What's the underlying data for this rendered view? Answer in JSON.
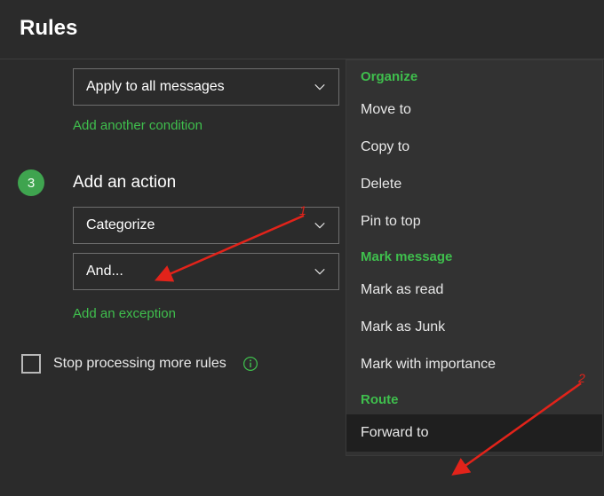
{
  "title": "Rules",
  "condition": {
    "select_label": "Apply to all messages",
    "add_link": "Add another condition"
  },
  "action": {
    "step_number": "3",
    "title": "Add an action",
    "select1_label": "Categorize",
    "select2_label": "And...",
    "add_link": "Add an exception"
  },
  "stop": {
    "label": "Stop processing more rules"
  },
  "menu": {
    "groups": [
      {
        "label": "Organize",
        "items": [
          "Move to",
          "Copy to",
          "Delete",
          "Pin to top"
        ]
      },
      {
        "label": "Mark message",
        "items": [
          "Mark as read",
          "Mark as Junk",
          "Mark with importance"
        ]
      },
      {
        "label": "Route",
        "items": [
          "Forward to"
        ]
      }
    ]
  },
  "annotation": {
    "a": "1",
    "b": "2"
  },
  "colors": {
    "accent": "#3fa44f",
    "red": "#e2231a"
  }
}
